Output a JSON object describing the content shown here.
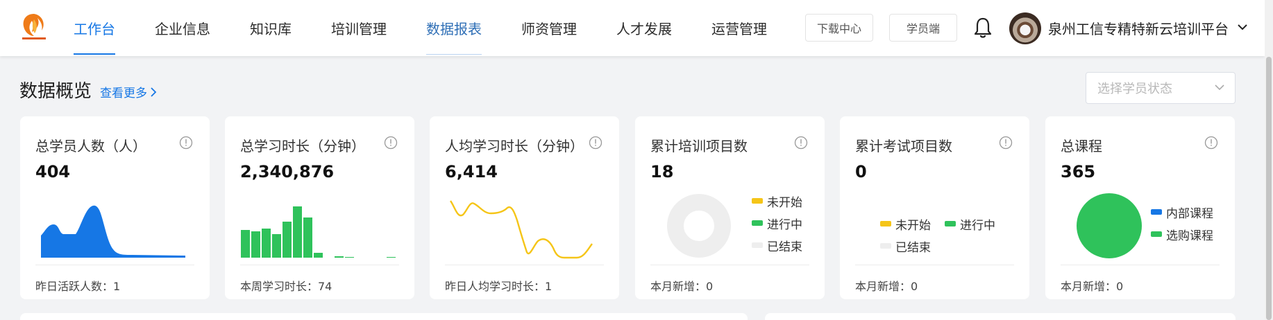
{
  "nav": {
    "items": [
      {
        "label": "工作台",
        "state": "active"
      },
      {
        "label": "企业信息",
        "state": ""
      },
      {
        "label": "知识库",
        "state": ""
      },
      {
        "label": "培训管理",
        "state": ""
      },
      {
        "label": "数据报表",
        "state": "hover"
      },
      {
        "label": "师资管理",
        "state": ""
      },
      {
        "label": "人才发展",
        "state": ""
      },
      {
        "label": "运营管理",
        "state": ""
      }
    ],
    "download_center": "下载中心",
    "student_portal": "学员端",
    "org_name": "泉州工信专精特新云培训平台"
  },
  "overview": {
    "title": "数据概览",
    "more_link": "查看更多",
    "status_placeholder": "选择学员状态"
  },
  "cards": {
    "students": {
      "title": "总学员人数（人）",
      "value": "404",
      "foot": "昨日活跃人数：1"
    },
    "study_time": {
      "title": "总学习时长（分钟）",
      "value": "2,340,876",
      "foot": "本周学习时长：74"
    },
    "avg_time": {
      "title": "人均学习时长（分钟）",
      "value": "6,414",
      "foot": "昨日人均学习时长：1"
    },
    "training": {
      "title": "累计培训项目数",
      "value": "18",
      "foot": "本月新增：0",
      "legend": [
        "未开始",
        "进行中",
        "已结束"
      ]
    },
    "exams": {
      "title": "累计考试项目数",
      "value": "0",
      "foot": "本月新增：0",
      "legend": [
        "未开始",
        "进行中",
        "已结束"
      ]
    },
    "courses": {
      "title": "总课程",
      "value": "365",
      "foot": "本月新增：0",
      "legend": [
        "内部课程",
        "选购课程"
      ]
    }
  },
  "colors": {
    "accent": "#1677e5",
    "blue_area": "#1677e5",
    "green": "#2fc25b",
    "yellow": "#f5c518",
    "gray": "#eeeeee"
  },
  "icons": {
    "info": "info-circle-icon",
    "bell": "bell-icon",
    "chevron": "chevron-down-icon"
  }
}
